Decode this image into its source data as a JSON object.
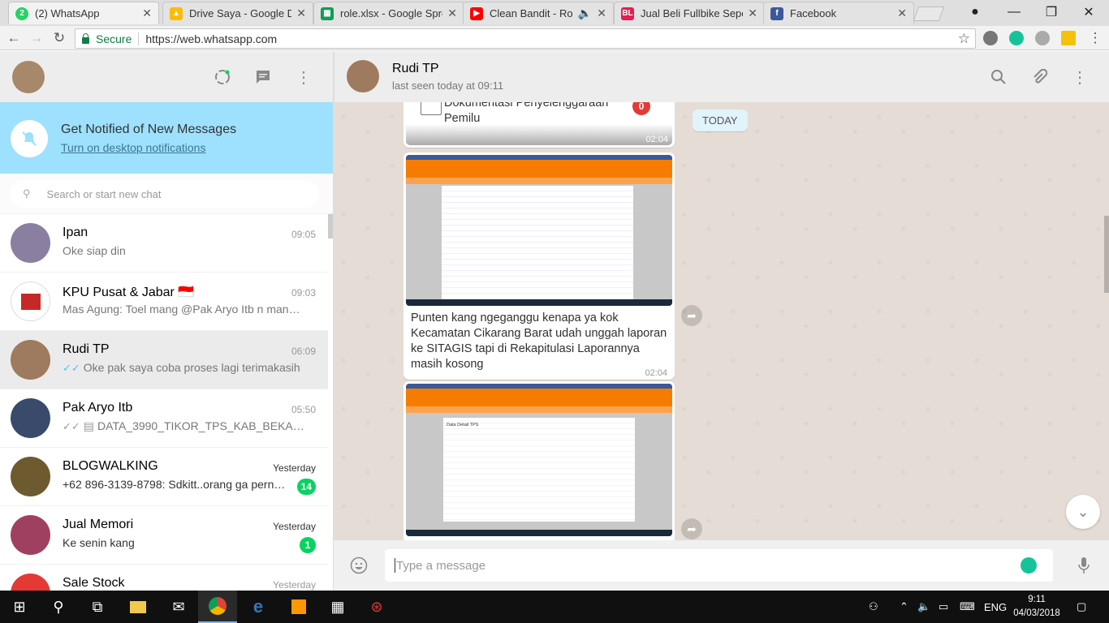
{
  "browser": {
    "tabs": [
      {
        "title": "(2) WhatsApp",
        "icon": "whatsapp-icon",
        "color": "#25d366",
        "active": true
      },
      {
        "title": "Drive Saya - Google Dri",
        "icon": "google-drive-icon",
        "color": "#fbbc05"
      },
      {
        "title": "role.xlsx - Google Sprea",
        "icon": "sheets-icon",
        "color": "#0f9d58"
      },
      {
        "title": "Clean Bandit - Rocka",
        "icon": "youtube-icon",
        "color": "#ff0000"
      },
      {
        "title": "Jual Beli Fullbike Seped",
        "icon": "bukalapak-icon",
        "color": "#e31e52"
      },
      {
        "title": "Facebook",
        "icon": "facebook-icon",
        "color": "#3b5998"
      }
    ],
    "secure_label": "Secure",
    "url": "https://web.whatsapp.com"
  },
  "notify": {
    "title": "Get Notified of New Messages",
    "link": "Turn on desktop notifications"
  },
  "search": {
    "placeholder": "Search or start new chat"
  },
  "chats": [
    {
      "name": "Ipan",
      "time": "09:05",
      "msg": "Oke siap din",
      "avatar_color": "#8a7fa0"
    },
    {
      "name": "KPU Pusat & Jabar 🇮🇩",
      "time": "09:03",
      "msg": "Mas Agung: Toel mang @Pak Aryo Itb n mang ...",
      "avatar_color": "#c62828"
    },
    {
      "name": "Rudi TP",
      "time": "06:09",
      "msg": "Oke pak saya coba proses lagi terimakasih",
      "avatar_color": "#9e7b5e",
      "ticks": "✓✓",
      "selected": true
    },
    {
      "name": "Pak Aryo Itb",
      "time": "05:50",
      "msg": "DATA_3990_TIKOR_TPS_KAB_BEKASI_1_...",
      "avatar_color": "#3a4a6a",
      "ticks": "✓✓",
      "doc": true
    },
    {
      "name": "BLOGWALKING",
      "time": "Yesterday",
      "msg": "+62 896-3139-8798: Sdkitt..orang ga perna...",
      "avatar_color": "#6d5a2e",
      "badge": "14"
    },
    {
      "name": "Jual Memori",
      "time": "Yesterday",
      "msg": "Ke senin kang",
      "avatar_color": "#a04060",
      "badge": "1"
    },
    {
      "name": "Sale Stock",
      "time": "Yesterday",
      "msg": "",
      "avatar_color": "#e53935"
    }
  ],
  "contact": {
    "name": "Rudi TP",
    "status": "last seen today at 09:11"
  },
  "conversation": {
    "today_label": "TODAY",
    "doc_title": "Dokumentasi Penyelenggaraan Pemilu",
    "doc_badge": "0",
    "doc_time": "02:04",
    "img1_caption": "Punten kang ngeganggu kenapa ya kok Kecamatan Cikarang Barat udah unggah laporan ke SITAGIS tapi di Rekapitulasi Laporannya masih kosong",
    "img1_time": "02:04",
    "img2_title": "Data Detail TPS"
  },
  "composer": {
    "placeholder": "Type a message"
  },
  "taskbar": {
    "lang": "ENG",
    "time": "9:11",
    "date": "04/03/2018"
  }
}
